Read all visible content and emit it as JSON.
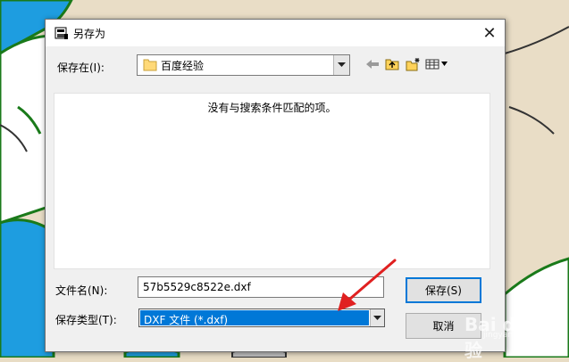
{
  "dialog": {
    "title": "另存为",
    "close_glyph": "✕"
  },
  "save_in": {
    "label": "保存在(I):",
    "value": "百度经验",
    "icon": "folder-icon"
  },
  "toolbar": {
    "icons": [
      "back-arrow-icon",
      "up-folder-icon",
      "new-folder-icon",
      "view-menu-icon"
    ]
  },
  "file_list": {
    "empty_message": "没有与搜索条件匹配的项。"
  },
  "file_name": {
    "label": "文件名(N):",
    "value": "57b5529c8522e.dxf"
  },
  "file_type": {
    "label": "保存类型(T):",
    "value": "DXF 文件 (*.dxf)"
  },
  "buttons": {
    "save": "保存(S)",
    "cancel": "取消"
  },
  "watermark": {
    "text": "Bai du 经验",
    "sub": "jingyan.baidu.com"
  },
  "colors": {
    "accent": "#0078d7",
    "annotation_arrow": "#e02020"
  }
}
